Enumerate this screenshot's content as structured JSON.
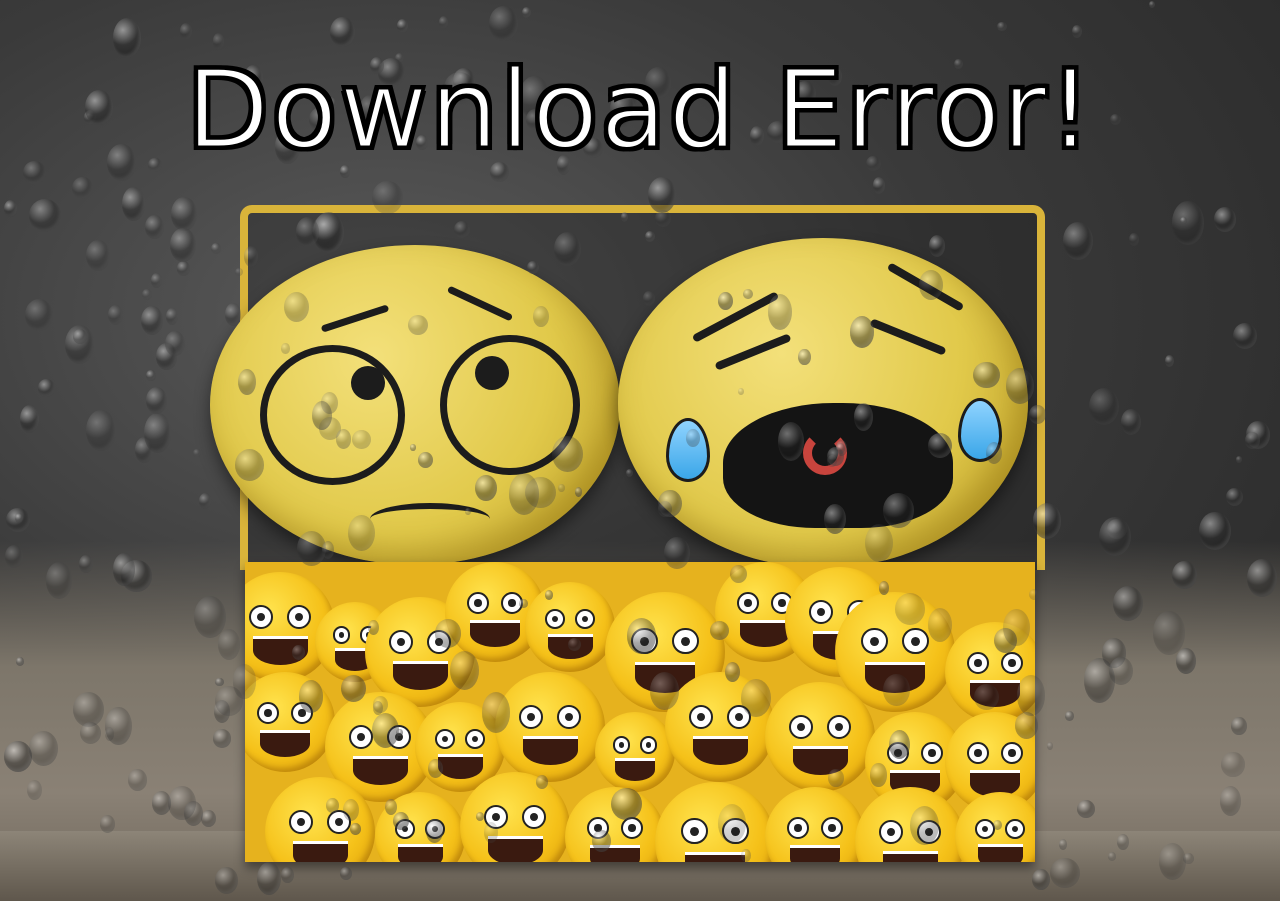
{
  "title": "Download Error!",
  "colors": {
    "title_text": "#ffffff",
    "title_outline": "#000000",
    "emoji_yellow": "#e6b21e",
    "tear_blue": "#3aa6e8",
    "background": "#3a3a3a"
  },
  "scene": {
    "icons": [
      "sad-face-plush-icon",
      "crying-face-plush-icon",
      "emoji-box-icon",
      "raindrops-icon"
    ]
  }
}
